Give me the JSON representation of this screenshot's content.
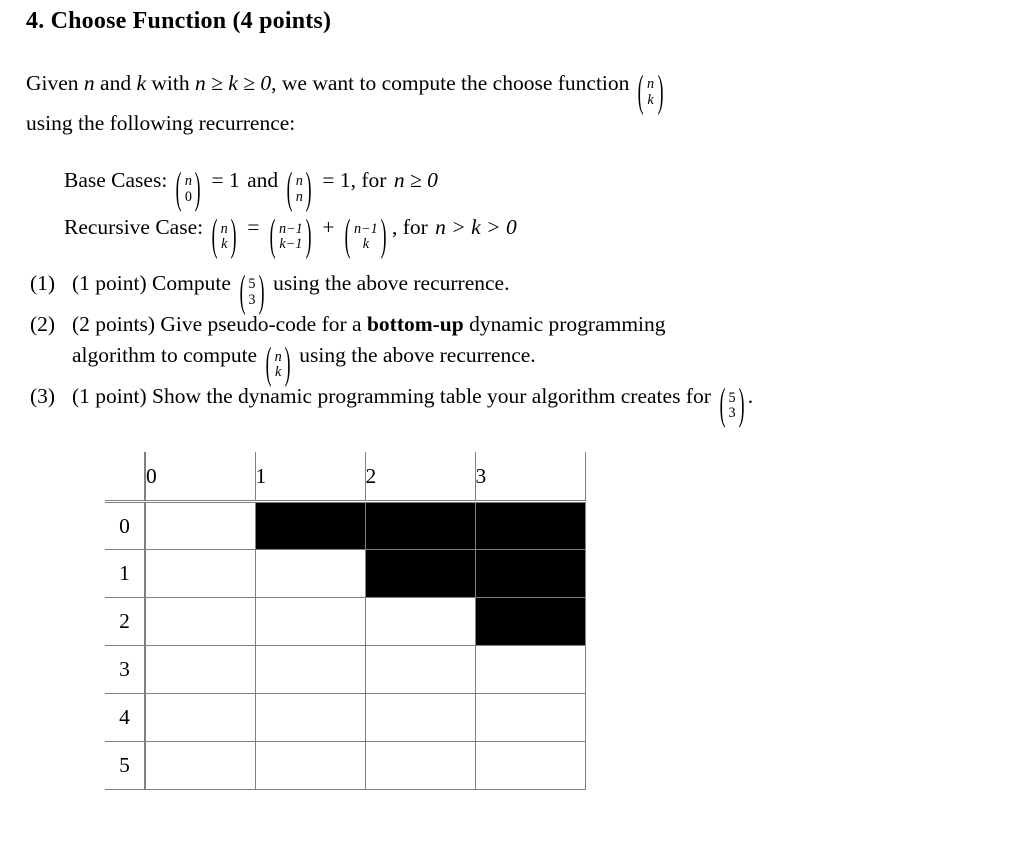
{
  "heading": "4. Choose Function (4 points)",
  "intro": {
    "line1_pre": "Given ",
    "n": "n",
    "and": " and ",
    "k": "k",
    "with": " with ",
    "condition": "n ≥ k ≥ 0",
    "line1_post": ", we want to compute the choose function ",
    "binom_top": "n",
    "binom_bot": "k",
    "line2": "using the following recurrence:"
  },
  "recurrence": {
    "base_label": "Base Cases:",
    "base_b1_top": "n",
    "base_b1_bot": "0",
    "base_eq1": "= 1",
    "base_and": "and",
    "base_b2_top": "n",
    "base_b2_bot": "n",
    "base_eq2": "= 1, for",
    "base_cond": "n ≥ 0",
    "rec_label": "Recursive Case:",
    "rec_lhs_top": "n",
    "rec_lhs_bot": "k",
    "rec_eq": "=",
    "rec_t1_top": "n−1",
    "rec_t1_bot": "k−1",
    "rec_plus": "+",
    "rec_t2_top": "n−1",
    "rec_t2_bot": "k",
    "rec_tail": ", for",
    "rec_cond": "n > k > 0"
  },
  "questions": [
    {
      "marker": "(1)",
      "points": "(1 point)",
      "text_pre": " Compute ",
      "binom_top": "5",
      "binom_bot": "3",
      "text_post": " using the above recurrence."
    },
    {
      "marker": "(2)",
      "points": "(2 points)",
      "text_pre": " Give pseudo-code for a ",
      "bold": "bottom-up",
      "text_mid": " dynamic programming",
      "line2_pre": "algorithm to compute ",
      "binom_top": "n",
      "binom_bot": "k",
      "line2_post": " using the above recurrence."
    },
    {
      "marker": "(3)",
      "points": "(1 point)",
      "text_pre": " Show the dynamic programming table your algorithm creates",
      "line2_pre": "for ",
      "binom_top": "5",
      "binom_bot": "3",
      "line2_post": "."
    }
  ],
  "dp_table": {
    "corner": "",
    "column_headers": [
      "0",
      "1",
      "2",
      "3"
    ],
    "row_headers": [
      "0",
      "1",
      "2",
      "3",
      "4",
      "5"
    ],
    "cells": [
      [
        "",
        "black",
        "black",
        "black"
      ],
      [
        "",
        "",
        "black",
        "black"
      ],
      [
        "",
        "",
        "",
        "black"
      ],
      [
        "",
        "",
        "",
        ""
      ],
      [
        "",
        "",
        "",
        ""
      ],
      [
        "",
        "",
        "",
        ""
      ]
    ]
  },
  "colors": {
    "grid": "#808080",
    "filled": "#000000",
    "text": "#000000",
    "background": "#ffffff"
  }
}
